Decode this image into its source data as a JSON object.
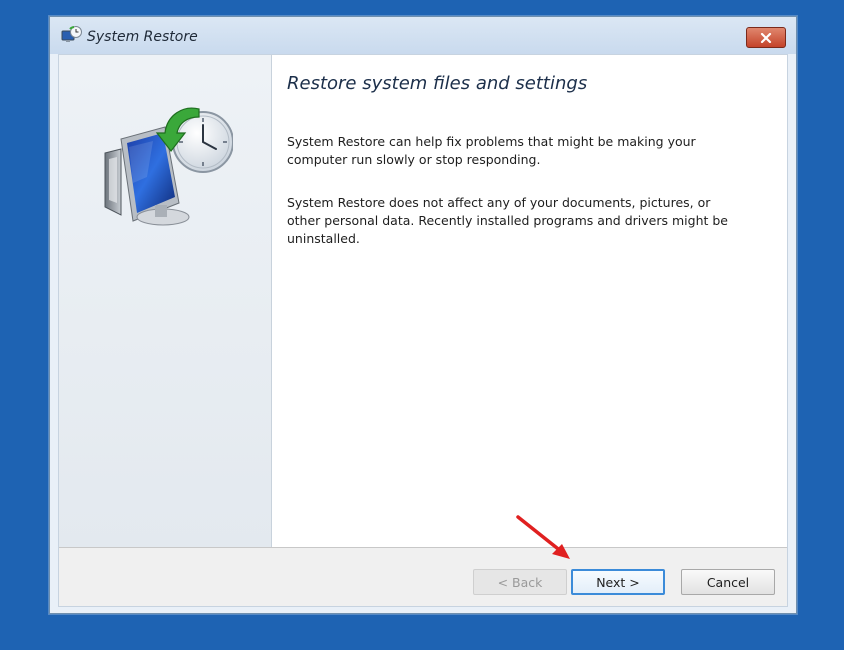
{
  "window": {
    "title": "System Restore",
    "close_icon": "close-icon"
  },
  "sidebar": {
    "icon": "system-restore-icon"
  },
  "main": {
    "heading": "Restore system files and settings",
    "paragraphs": [
      "System Restore can help fix problems that might be making your computer run slowly or stop responding.",
      "System Restore does not affect any of your documents, pictures, or other personal data. Recently installed programs and drivers might be uninstalled."
    ]
  },
  "footer": {
    "back_label": "< Back",
    "next_label": "Next >",
    "cancel_label": "Cancel"
  },
  "colors": {
    "desktop": "#1e63b3",
    "close_button": "#c4432a",
    "next_focus": "#3b8bd9",
    "annotation_arrow": "#e02020"
  }
}
